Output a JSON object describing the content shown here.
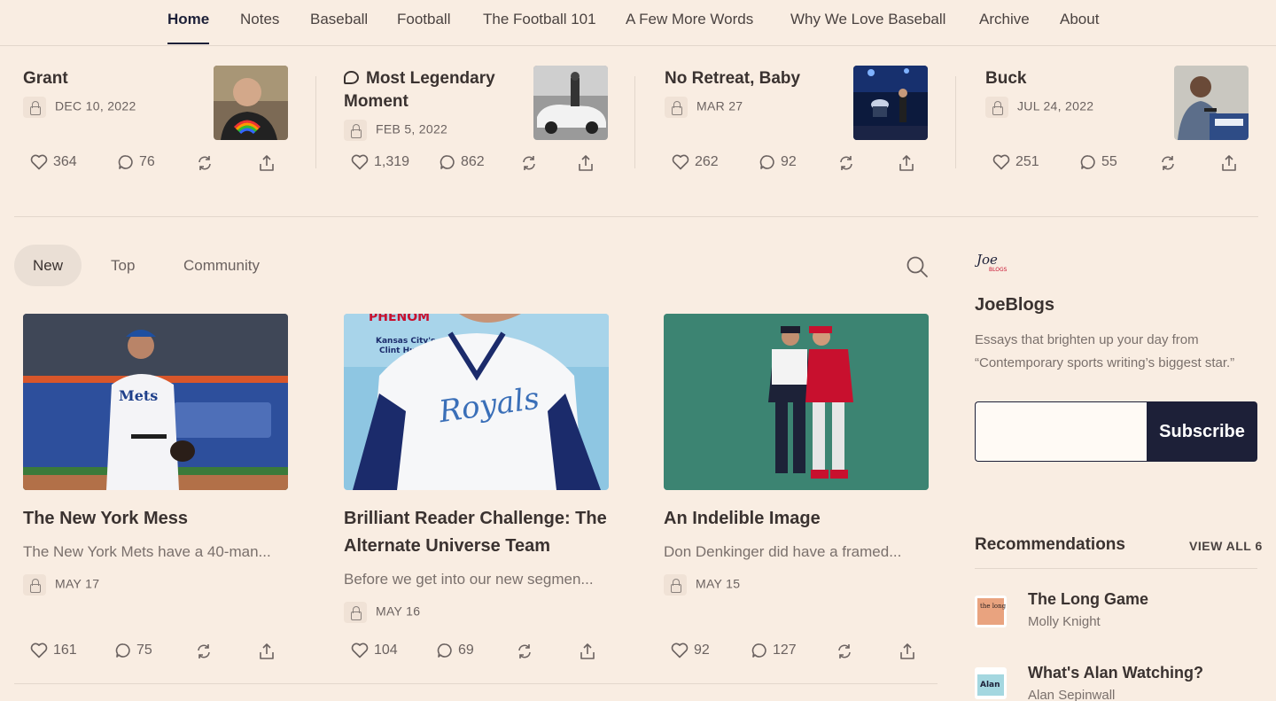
{
  "nav": [
    {
      "label": "Home",
      "active": true
    },
    {
      "label": "Notes"
    },
    {
      "label": "Baseball"
    },
    {
      "label": "Football"
    },
    {
      "label": "The Football 101"
    },
    {
      "label": "A Few More Words"
    },
    {
      "label": "Why We Love Baseball"
    },
    {
      "label": "Archive"
    },
    {
      "label": "About"
    }
  ],
  "featured": [
    {
      "title": "Grant",
      "date": "DEC 10, 2022",
      "likes": "364",
      "comments": "76"
    },
    {
      "title": "Most Legendary Moment",
      "date": "FEB 5, 2022",
      "likes": "1,319",
      "comments": "862"
    },
    {
      "title": "No Retreat, Baby",
      "date": "MAR 27",
      "likes": "262",
      "comments": "92"
    },
    {
      "title": "Buck",
      "date": "JUL 24, 2022",
      "likes": "251",
      "comments": "55"
    }
  ],
  "tabs": [
    {
      "label": "New",
      "active": true
    },
    {
      "label": "Top"
    },
    {
      "label": "Community"
    }
  ],
  "posts": [
    {
      "title": "The New York Mess",
      "subtitle": "The New York Mets have a 40-man...",
      "date": "MAY 17",
      "likes": "161",
      "comments": "75"
    },
    {
      "title": "Brilliant Reader Challenge: The Alternate Universe Team",
      "subtitle": "Before we get into our new segmen...",
      "date": "MAY 16",
      "likes": "104",
      "comments": "69",
      "image_text": {
        "banner": "PHENOM",
        "caption_line1": "Kansas City's",
        "caption_line2": "Clint Hurdle",
        "jersey": "Royals"
      }
    },
    {
      "title": "An Indelible Image",
      "subtitle": "Don Denkinger did have a framed...",
      "date": "MAY 15",
      "likes": "92",
      "comments": "127"
    }
  ],
  "sidebar": {
    "logo_text": {
      "line1": "Joe",
      "line2": "BLOGS"
    },
    "name": "JoeBlogs",
    "description": "Essays that brighten up your day from “Contemporary sports writing’s biggest star.”",
    "email_placeholder": "",
    "subscribe_label": "Subscribe",
    "recommendations_heading": "Recommendations",
    "view_all_label": "VIEW ALL 6",
    "recommendations": [
      {
        "title": "The Long Game",
        "author": "Molly Knight",
        "thumb_text": "the long game"
      },
      {
        "title": "What's Alan Watching?",
        "author": "Alan Sepinwall",
        "thumb_text": "Alan"
      }
    ]
  },
  "colors": {
    "background": "#f9ede2",
    "accent_navy": "#1d2038",
    "text": "#3a3230",
    "muted": "#7a706c"
  }
}
